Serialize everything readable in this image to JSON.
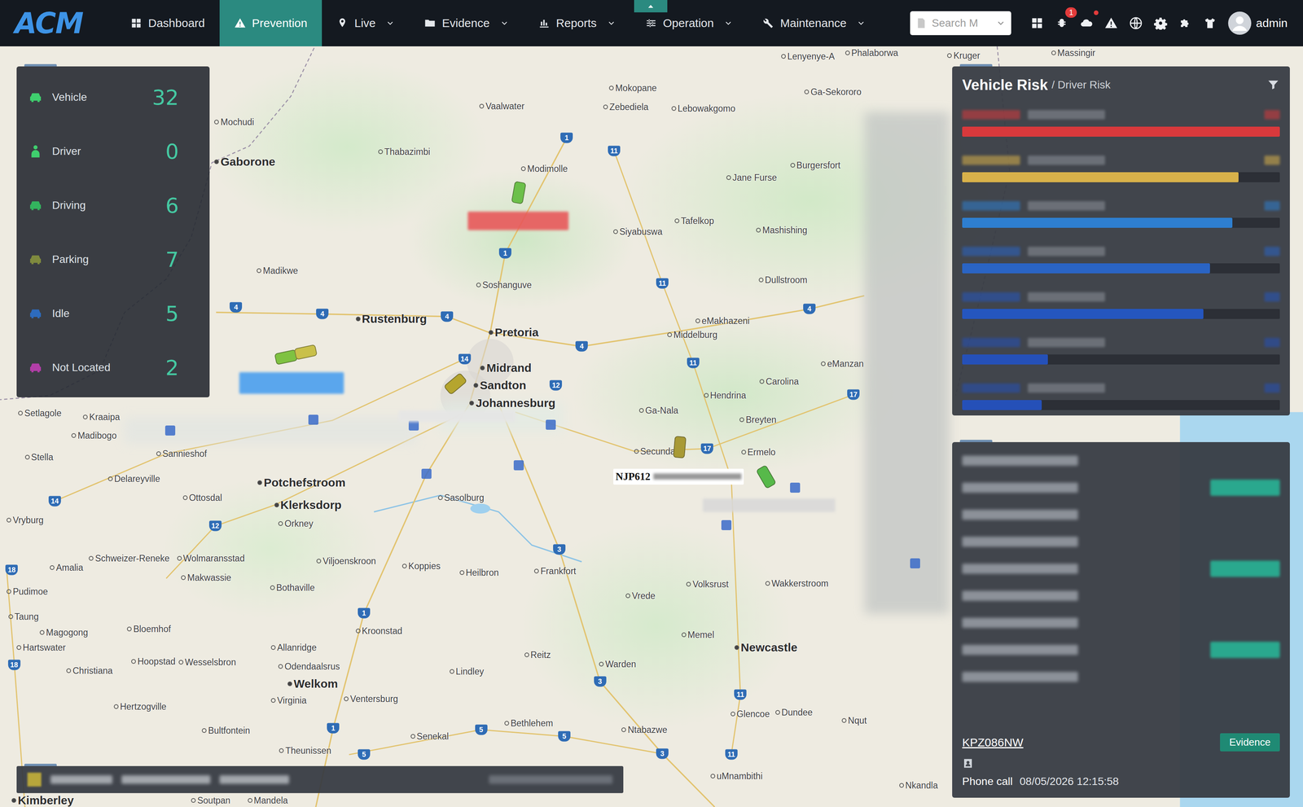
{
  "nav": {
    "logo": "ACM",
    "items": [
      {
        "label": "Dashboard",
        "selected": false,
        "dropdown": false
      },
      {
        "label": "Prevention",
        "selected": true,
        "dropdown": false
      },
      {
        "label": "Live",
        "selected": false,
        "dropdown": true
      },
      {
        "label": "Evidence",
        "selected": false,
        "dropdown": true
      },
      {
        "label": "Reports",
        "selected": false,
        "dropdown": true
      },
      {
        "label": "Operation",
        "selected": false,
        "dropdown": true
      },
      {
        "label": "Maintenance",
        "selected": false,
        "dropdown": true
      }
    ],
    "search": {
      "placeholder": "Search M"
    },
    "notification_badge": "1",
    "upload_alert": true,
    "user": "admin"
  },
  "stats": [
    {
      "label": "Vehicle",
      "count": "32",
      "kind": "car",
      "color": "#3fcf6e"
    },
    {
      "label": "Driver",
      "count": "0",
      "kind": "person",
      "color": "#3fcf6e"
    },
    {
      "label": "Driving",
      "count": "6",
      "kind": "car",
      "color": "#33b45e"
    },
    {
      "label": "Parking",
      "count": "7",
      "kind": "car",
      "color": "#7f8a3e"
    },
    {
      "label": "Idle",
      "count": "5",
      "kind": "car",
      "color": "#2d6bbd"
    },
    {
      "label": "Not Located",
      "count": "2",
      "kind": "car",
      "color": "#b23ea8"
    }
  ],
  "map": {
    "places": [
      {
        "name": "Lenyenye-A",
        "kind": "town"
      },
      {
        "name": "Phalaborwa",
        "kind": "town"
      },
      {
        "name": "Kruger",
        "kind": "town"
      },
      {
        "name": "Massingir",
        "kind": "town"
      },
      {
        "name": "Mokopane",
        "kind": "town"
      },
      {
        "name": "Ga-Sekororo",
        "kind": "town"
      },
      {
        "name": "Zebediela",
        "kind": "town"
      },
      {
        "name": "Lebowakgomo",
        "kind": "town"
      },
      {
        "name": "Vaalwater",
        "kind": "town"
      },
      {
        "name": "Thabazimbi",
        "kind": "town"
      },
      {
        "name": "Modimolle",
        "kind": "town"
      },
      {
        "name": "Burgersfort",
        "kind": "town"
      },
      {
        "name": "Jane Furse",
        "kind": "town"
      },
      {
        "name": "Gaborone",
        "kind": "city"
      },
      {
        "name": "Mochudi",
        "kind": "town"
      },
      {
        "name": "Siyabuswa",
        "kind": "town"
      },
      {
        "name": "Tafelkop",
        "kind": "town"
      },
      {
        "name": "Mashishing",
        "kind": "town"
      },
      {
        "name": "Madikwe",
        "kind": "town"
      },
      {
        "name": "Soshanguve",
        "kind": "town"
      },
      {
        "name": "Dullstroom",
        "kind": "town"
      },
      {
        "name": "Rustenburg",
        "kind": "city"
      },
      {
        "name": "Pretoria",
        "kind": "city"
      },
      {
        "name": "eMakhazeni",
        "kind": "town"
      },
      {
        "name": "Middelburg",
        "kind": "town"
      },
      {
        "name": "Midrand",
        "kind": "city"
      },
      {
        "name": "Sandton",
        "kind": "city"
      },
      {
        "name": "Johannesburg",
        "kind": "city"
      },
      {
        "name": "Carolina",
        "kind": "town"
      },
      {
        "name": "eManzan",
        "kind": "town"
      },
      {
        "name": "Hendrina",
        "kind": "town"
      },
      {
        "name": "Ga-Nala",
        "kind": "town"
      },
      {
        "name": "Breyten",
        "kind": "town"
      },
      {
        "name": "Setlagole",
        "kind": "town"
      },
      {
        "name": "Kraaipa",
        "kind": "town"
      },
      {
        "name": "Madibogo",
        "kind": "town"
      },
      {
        "name": "Stella",
        "kind": "town"
      },
      {
        "name": "Sannieshof",
        "kind": "town"
      },
      {
        "name": "Secunda",
        "kind": "town"
      },
      {
        "name": "Ermelo",
        "kind": "town"
      },
      {
        "name": "Delareyville",
        "kind": "town"
      },
      {
        "name": "Potchefstroom",
        "kind": "city"
      },
      {
        "name": "Ottosdal",
        "kind": "town"
      },
      {
        "name": "Klerksdorp",
        "kind": "city"
      },
      {
        "name": "Sasolburg",
        "kind": "town"
      },
      {
        "name": "Vryburg",
        "kind": "town"
      },
      {
        "name": "Orkney",
        "kind": "town"
      },
      {
        "name": "Schweizer-Reneke",
        "kind": "town"
      },
      {
        "name": "Wolmaransstad",
        "kind": "town"
      },
      {
        "name": "Amalia",
        "kind": "town"
      },
      {
        "name": "Makwassie",
        "kind": "town"
      },
      {
        "name": "Viljoenskroon",
        "kind": "town"
      },
      {
        "name": "Koppies",
        "kind": "town"
      },
      {
        "name": "Heilbron",
        "kind": "town"
      },
      {
        "name": "Frankfort",
        "kind": "town"
      },
      {
        "name": "Bothaville",
        "kind": "town"
      },
      {
        "name": "Pudimoe",
        "kind": "town"
      },
      {
        "name": "Vrede",
        "kind": "town"
      },
      {
        "name": "Volksrust",
        "kind": "town"
      },
      {
        "name": "Wakkerstroom",
        "kind": "town"
      },
      {
        "name": "Taung",
        "kind": "town"
      },
      {
        "name": "Magogong",
        "kind": "town"
      },
      {
        "name": "Bloemhof",
        "kind": "town"
      },
      {
        "name": "Kroonstad",
        "kind": "town"
      },
      {
        "name": "Hartswater",
        "kind": "town"
      },
      {
        "name": "Allanridge",
        "kind": "town"
      },
      {
        "name": "Memel",
        "kind": "town"
      },
      {
        "name": "Newcastle",
        "kind": "city"
      },
      {
        "name": "Reitz",
        "kind": "town"
      },
      {
        "name": "Christiana",
        "kind": "town"
      },
      {
        "name": "Hoopstad",
        "kind": "town"
      },
      {
        "name": "Wesselsbron",
        "kind": "town"
      },
      {
        "name": "Odendaalsrus",
        "kind": "town"
      },
      {
        "name": "Lindley",
        "kind": "town"
      },
      {
        "name": "Warden",
        "kind": "town"
      },
      {
        "name": "Welkom",
        "kind": "city"
      },
      {
        "name": "Virginia",
        "kind": "town"
      },
      {
        "name": "Ventersburg",
        "kind": "town"
      },
      {
        "name": "Glencoe",
        "kind": "town"
      },
      {
        "name": "Dundee",
        "kind": "town"
      },
      {
        "name": "Nqut",
        "kind": "town"
      },
      {
        "name": "Hertzogville",
        "kind": "town"
      },
      {
        "name": "Bultfontein",
        "kind": "town"
      },
      {
        "name": "Bethlehem",
        "kind": "town"
      },
      {
        "name": "Ntabazwe",
        "kind": "town"
      },
      {
        "name": "Senekal",
        "kind": "town"
      },
      {
        "name": "Theunissen",
        "kind": "town"
      },
      {
        "name": "uMnambithi",
        "kind": "town"
      },
      {
        "name": "Nkandla",
        "kind": "town"
      },
      {
        "name": "Kimberley",
        "kind": "city"
      },
      {
        "name": "Soutpan",
        "kind": "town"
      },
      {
        "name": "Mandela",
        "kind": "town"
      }
    ],
    "road_shields": [
      "1",
      "1",
      "1",
      "1",
      "4",
      "4",
      "4",
      "4",
      "4",
      "11",
      "11",
      "11",
      "11",
      "11",
      "12",
      "12",
      "14",
      "14",
      "17",
      "17",
      "18",
      "18",
      "3",
      "3",
      "3",
      "5",
      "5",
      "5"
    ],
    "vehicle_markers": [
      {
        "color": "#7fc241"
      },
      {
        "color": "#c9c04a"
      },
      {
        "color": "#b5a52e"
      },
      {
        "color": "#6cc04a"
      },
      {
        "color": "#a89a35"
      },
      {
        "color": "#57b94a"
      }
    ],
    "stops": [
      {
        "color": "#3a6bc9"
      },
      {
        "color": "#3a6bc9"
      },
      {
        "color": "#3a6bc9"
      },
      {
        "color": "#3a6bc9"
      },
      {
        "color": "#3a6bc9"
      },
      {
        "color": "#3a6bc9"
      },
      {
        "color": "#3a6bc9"
      },
      {
        "color": "#3a6bc9"
      },
      {
        "color": "#3a6bc9"
      }
    ],
    "tags": [
      {
        "text": "NJP612",
        "redacted": false,
        "color": "#ffffff"
      },
      {
        "redacted": true,
        "color": "#e8585a"
      },
      {
        "redacted": true,
        "color": "#4a9fef"
      },
      {
        "redacted": true,
        "color": "#d9d9d9"
      },
      {
        "redacted": true,
        "color": "#e6e6e6"
      }
    ]
  },
  "risk_panel": {
    "title": "Vehicle Risk",
    "subtitle": "/ Driver Risk",
    "rows": [
      {
        "level": 1.0,
        "color": "#d9393c"
      },
      {
        "level": 0.87,
        "color": "#d8b14a"
      },
      {
        "level": 0.85,
        "color": "#2e7fd0"
      },
      {
        "level": 0.78,
        "color": "#2a64c4"
      },
      {
        "level": 0.76,
        "color": "#2556bf"
      },
      {
        "level": 0.27,
        "color": "#2550b8"
      },
      {
        "level": 0.25,
        "color": "#2550b8"
      }
    ]
  },
  "event_panel": {
    "rows": [
      {
        "badge": false
      },
      {
        "badge": true
      },
      {
        "badge": false
      },
      {
        "badge": false
      },
      {
        "badge": true
      },
      {
        "badge": false
      },
      {
        "badge": false
      },
      {
        "badge": true
      },
      {
        "badge": false
      }
    ],
    "plate": "KPZ086NW",
    "button": "Evidence",
    "event": "Phone call",
    "time": "08/05/2026 12:15:58"
  }
}
